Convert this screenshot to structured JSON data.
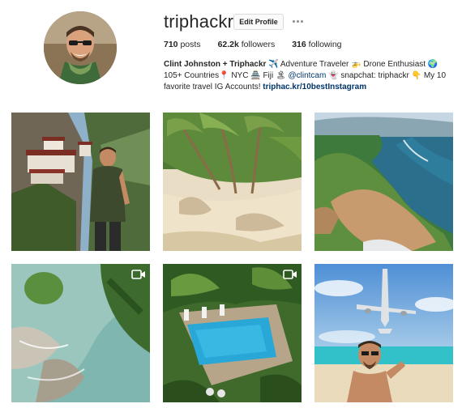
{
  "profile": {
    "username": "triphackr",
    "edit_profile_label": "Edit Profile",
    "stats": {
      "posts_count": "710",
      "posts_label": "posts",
      "followers_count": "62.2k",
      "followers_label": "followers",
      "following_count": "316",
      "following_label": "following"
    },
    "bio": {
      "name": "Clint Johnston + Triphackr",
      "line1": " ✈️ Adventure Traveler 🚁 Drone Enthusiast 🌍 105+ Countries📍 NYC 🏯 Fiji 🏝 ",
      "mention": "@clintcam",
      "line2": " 👻 snapchat: triphackr 👇 My 10 favorite travel IG Accounts! ",
      "link": "triphac.kr/10bestInstagram"
    }
  },
  "posts": [
    {
      "subject": "monastery-cliff-hiker",
      "is_video": false
    },
    {
      "subject": "palm-beach",
      "is_video": false
    },
    {
      "subject": "aerial-coastline",
      "is_video": false
    },
    {
      "subject": "aerial-island-lagoon",
      "is_video": true
    },
    {
      "subject": "aerial-pool",
      "is_video": true
    },
    {
      "subject": "plane-beach-selfie",
      "is_video": false
    }
  ],
  "colors": {
    "link": "#003569",
    "text": "#262626",
    "border": "#dbdbdb"
  }
}
